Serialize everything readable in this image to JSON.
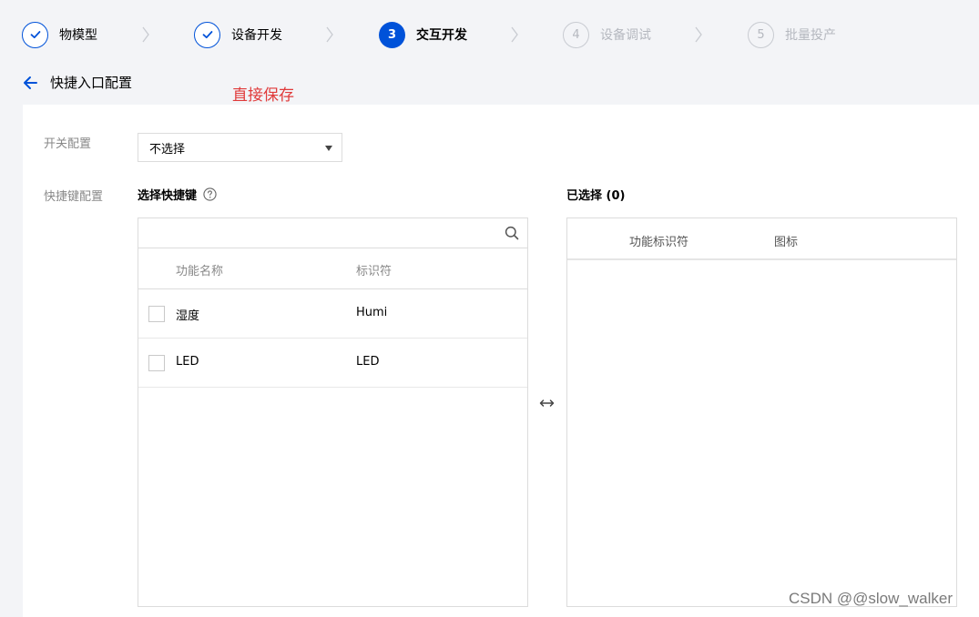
{
  "stepper": {
    "steps": [
      {
        "label": "物模型",
        "state": "done"
      },
      {
        "label": "设备开发",
        "state": "done"
      },
      {
        "label": "交互开发",
        "state": "active",
        "number": "3"
      },
      {
        "label": "设备调试",
        "state": "todo",
        "number": "4"
      },
      {
        "label": "批量投产",
        "state": "todo",
        "number": "5"
      }
    ]
  },
  "header": {
    "title": "快捷入口配置",
    "annotation": "直接保存"
  },
  "form": {
    "switch_label": "开关配置",
    "switch_select_value": "不选择",
    "shortcut_label": "快捷键配置"
  },
  "left_panel": {
    "title": "选择快捷键",
    "search_placeholder": "",
    "columns": [
      "功能名称",
      "标识符"
    ],
    "rows": [
      {
        "name": "湿度",
        "id": "Humi"
      },
      {
        "name": "LED",
        "id": "LED"
      }
    ]
  },
  "right_panel": {
    "title": "已选择 (0)",
    "columns": [
      "功能标识符",
      "图标"
    ]
  },
  "watermark": "CSDN @@slow_walker",
  "colors": {
    "accent": "#0052d9",
    "annotation": "#e03a3a",
    "muted": "#b5b8bf"
  }
}
